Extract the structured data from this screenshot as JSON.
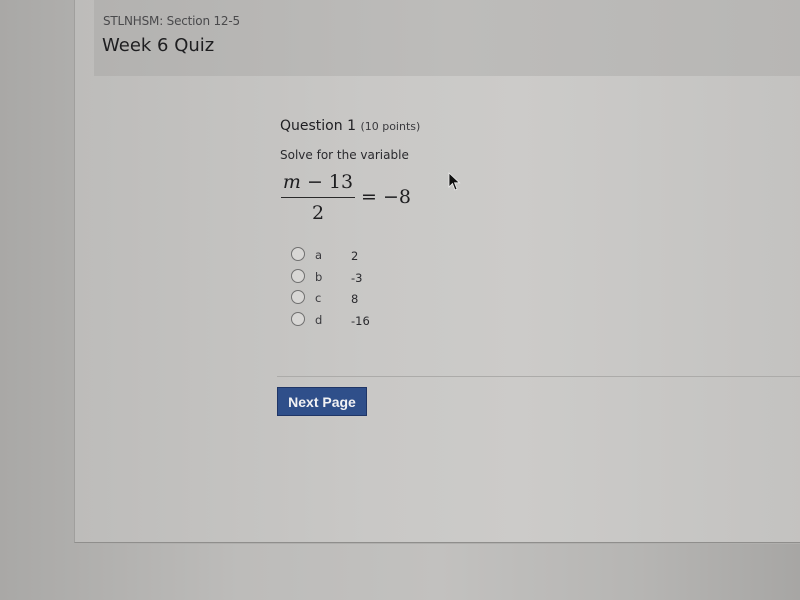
{
  "header": {
    "breadcrumb": "STLNHSM: Section 12-5",
    "title": "Week 6 Quiz"
  },
  "question": {
    "label": "Question 1",
    "points": "(10 points)",
    "prompt": "Solve for the variable",
    "equation": {
      "numerator_var": "m",
      "numerator_rest": " − 13",
      "denominator": "2",
      "rhs": "= −8"
    },
    "options": [
      {
        "letter": "a",
        "value": "2",
        "selected": false
      },
      {
        "letter": "b",
        "value": "-3",
        "selected": false
      },
      {
        "letter": "c",
        "value": "8",
        "selected": false
      },
      {
        "letter": "d",
        "value": "-16",
        "selected": false
      }
    ]
  },
  "actions": {
    "next_label": "Next Page"
  },
  "colors": {
    "button_bg": "#2f4f8a",
    "topbar": "#1c2440"
  }
}
